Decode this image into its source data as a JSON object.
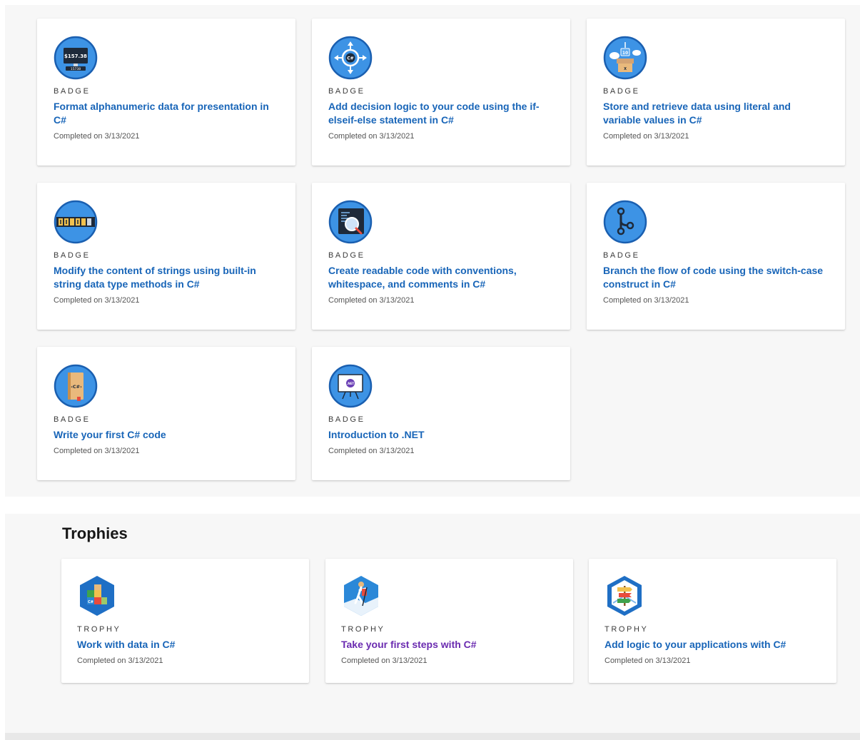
{
  "badges": [
    {
      "kind": "BADGE",
      "title": "Format alphanumeric data for presentation in C#",
      "completed": "Completed on 3/13/2021",
      "icon": "monitor-price-icon",
      "icon_text": "$157.38",
      "icon_text2": "15738"
    },
    {
      "kind": "BADGE",
      "title": "Add decision logic to your code using the if-elseif-else statement in C#",
      "completed": "Completed on 3/13/2021",
      "icon": "decision-arrows-icon",
      "icon_text": "C#"
    },
    {
      "kind": "BADGE",
      "title": "Store and retrieve data using literal and variable values in C#",
      "completed": "Completed on 3/13/2021",
      "icon": "storage-box-icon",
      "icon_text": "10",
      "icon_text2": "X"
    },
    {
      "kind": "BADGE",
      "title": "Modify the content of strings using built-in string data type methods in C#",
      "completed": "Completed on 3/13/2021",
      "icon": "string-blocks-icon"
    },
    {
      "kind": "BADGE",
      "title": "Create readable code with conventions, whitespace, and comments in C#",
      "completed": "Completed on 3/13/2021",
      "icon": "code-magnifier-icon"
    },
    {
      "kind": "BADGE",
      "title": "Branch the flow of code using the switch-case construct in C#",
      "completed": "Completed on 3/13/2021",
      "icon": "branch-icon"
    },
    {
      "kind": "BADGE",
      "title": "Write your first C# code",
      "completed": "Completed on 3/13/2021",
      "icon": "csharp-book-icon",
      "icon_text": "‹C#›"
    },
    {
      "kind": "BADGE",
      "title": "Introduction to .NET",
      "completed": "Completed on 3/13/2021",
      "icon": "dotnet-presentation-icon",
      "icon_text": ".NET"
    }
  ],
  "trophies_heading": "Trophies",
  "trophies": [
    {
      "kind": "TROPHY",
      "title": "Work with data in C#",
      "completed": "Completed on 3/13/2021",
      "icon": "data-blocks-trophy-icon",
      "visited": false,
      "icon_text": "C#"
    },
    {
      "kind": "TROPHY",
      "title": "Take your first steps with C#",
      "completed": "Completed on 3/13/2021",
      "icon": "hiker-trophy-icon",
      "visited": true
    },
    {
      "kind": "TROPHY",
      "title": "Add logic to your applications with C#",
      "completed": "Completed on 3/13/2021",
      "icon": "signpost-trophy-icon",
      "visited": false
    }
  ],
  "colors": {
    "link": "#1865b8",
    "visited_link": "#6a2bb0",
    "badge_blue": "#2b88d8",
    "section_bg": "#f7f7f7"
  }
}
